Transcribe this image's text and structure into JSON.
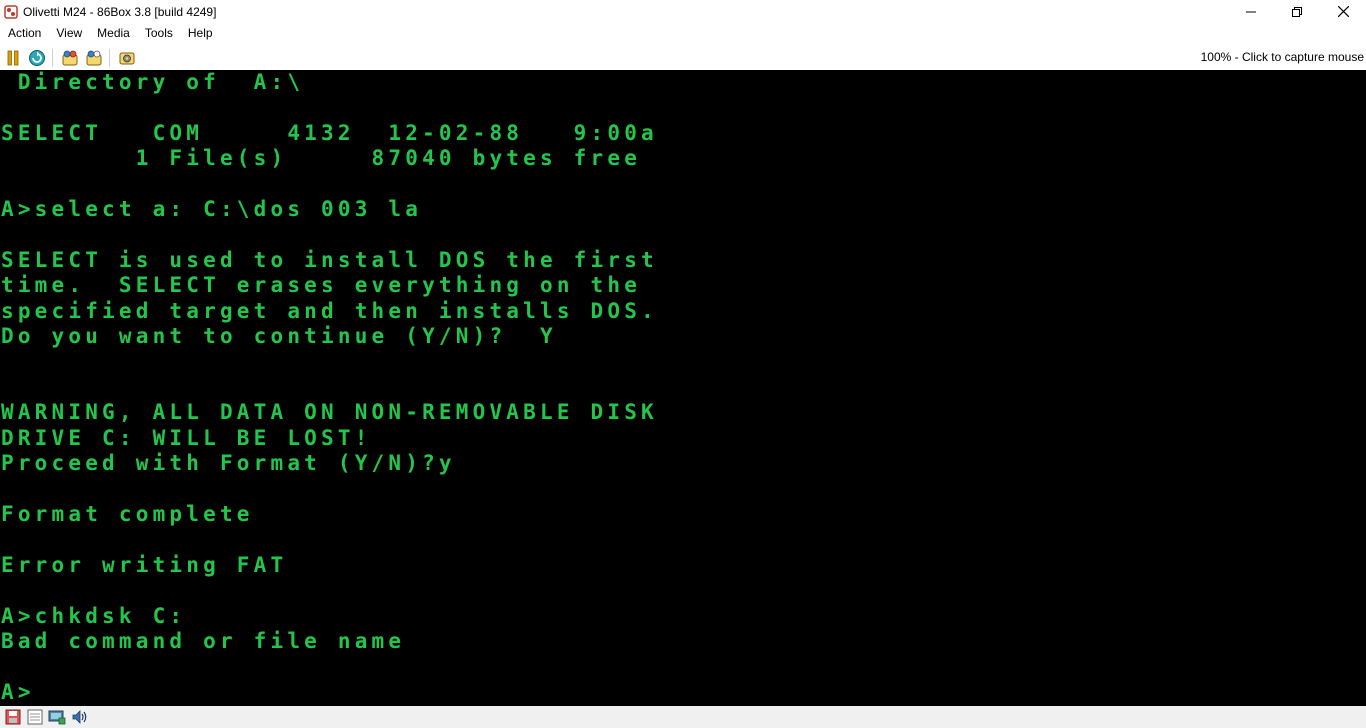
{
  "window": {
    "title": "Olivetti M24 - 86Box 3.8 [build 4249]",
    "minimize_glyph": "—",
    "maximize_glyph": "❐",
    "close_glyph": "✕"
  },
  "menu": {
    "items": [
      "Action",
      "View",
      "Media",
      "Tools",
      "Help"
    ]
  },
  "toolbar": {
    "buttons": [
      "pause-icon",
      "hard-reset-icon",
      "ctrl-alt-del-icon",
      "ctrl-alt-esc-icon",
      "settings-icon"
    ],
    "capture_status": "100% - Click to capture mouse"
  },
  "terminal": {
    "color": "#23c64a",
    "lines": [
      " Directory of  A:\\",
      "",
      "SELECT   COM     4132  12-02-88   9:00a",
      "        1 File(s)     87040 bytes free",
      "",
      "A>select a: C:\\dos 003 la",
      "",
      "SELECT is used to install DOS the first",
      "time.  SELECT erases everything on the",
      "specified target and then installs DOS.",
      "Do you want to continue (Y/N)?  Y",
      "",
      "",
      "WARNING, ALL DATA ON NON-REMOVABLE DISK",
      "DRIVE C: WILL BE LOST!",
      "Proceed with Format (Y/N)?y",
      "",
      "Format complete",
      "",
      "Error writing FAT",
      "",
      "A>chkdsk C:",
      "Bad command or file name",
      "",
      "A>"
    ]
  },
  "statusbar": {
    "icons": [
      "floppy-drive-icon",
      "cassette-icon",
      "network-icon",
      "sound-icon"
    ]
  }
}
